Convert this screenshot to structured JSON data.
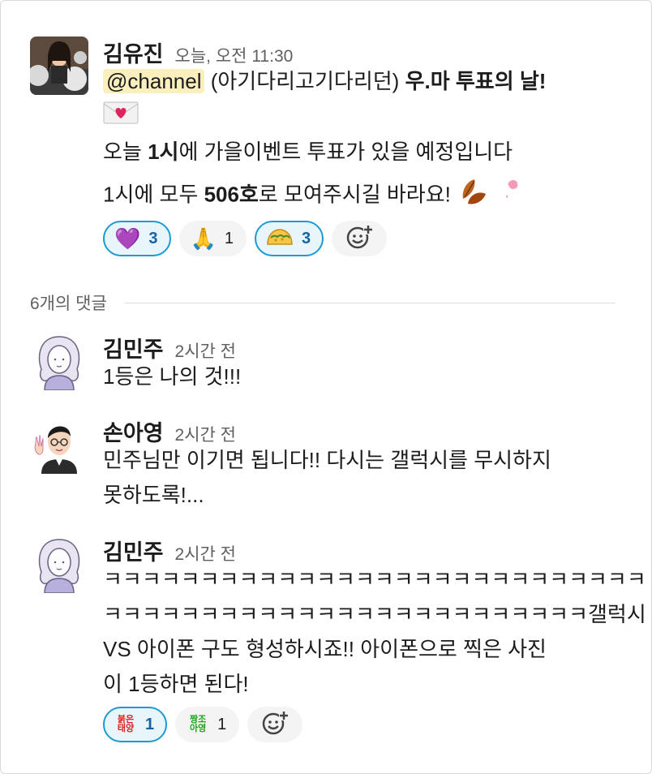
{
  "thread": {
    "comment_count_label": "6개의 댓글"
  },
  "parent": {
    "author": "김유진",
    "time": "오늘, 오전 11:30",
    "mention": "@channel",
    "title_rest": "(아기다리고기다리던)",
    "title_bold": "우.마 투표의 날!",
    "line2_pre": "오늘 ",
    "line2_bold": "1시",
    "line2_post": "에 가을이벤트 투표가 있을 예정입니다",
    "line3_pre": "1시에 모두 ",
    "line3_bold": "506호",
    "line3_post": "로 모여주시길 바라요!",
    "reactions": [
      {
        "emoji": "💜",
        "count": "3",
        "mine": true
      },
      {
        "emoji": "🙏",
        "count": "1",
        "mine": false
      },
      {
        "emoji": "taco",
        "count": "3",
        "mine": true
      }
    ]
  },
  "replies": [
    {
      "author": "김민주",
      "time": "2시간 전",
      "text": "1등은 나의 것!!!"
    },
    {
      "author": "손아영",
      "time": "2시간 전",
      "text_line1": "민주님만 이기면 됩니다!! 다시는 갤럭시를 무시하지",
      "text_line2": "못하도록!..."
    },
    {
      "author": "김민주",
      "time": "2시간 전",
      "text_line1": "ㅋㅋㅋㅋㅋㅋㅋㅋㅋㅋㅋㅋㅋㅋㅋㅋㅋㅋㅋㅋㅋㅋㅋㅋㅋㅋㅋㅋ",
      "text_line2": "ㅋㅋㅋㅋㅋㅋㅋㅋㅋㅋㅋㅋㅋㅋㅋㅋㅋㅋㅋㅋㅋㅋㅋㅋㅋ갤럭시",
      "text_line3": "VS 아이폰 구도 형성하시죠!! 아이폰으로 찍은 사진",
      "text_line4": "이 1등하면 된다!",
      "reactions": [
        {
          "emoji_text_top": "붉은",
          "emoji_text_bottom": "태양",
          "count": "1",
          "mine": true
        },
        {
          "emoji_text_top": "짱조",
          "emoji_text_bottom": "아영",
          "count": "1",
          "mine": false
        }
      ]
    }
  ],
  "colors": {
    "mention_bg": "#fbefbd",
    "reaction_active_border": "#1d9bd1",
    "reaction_active_text": "#1264a3"
  }
}
